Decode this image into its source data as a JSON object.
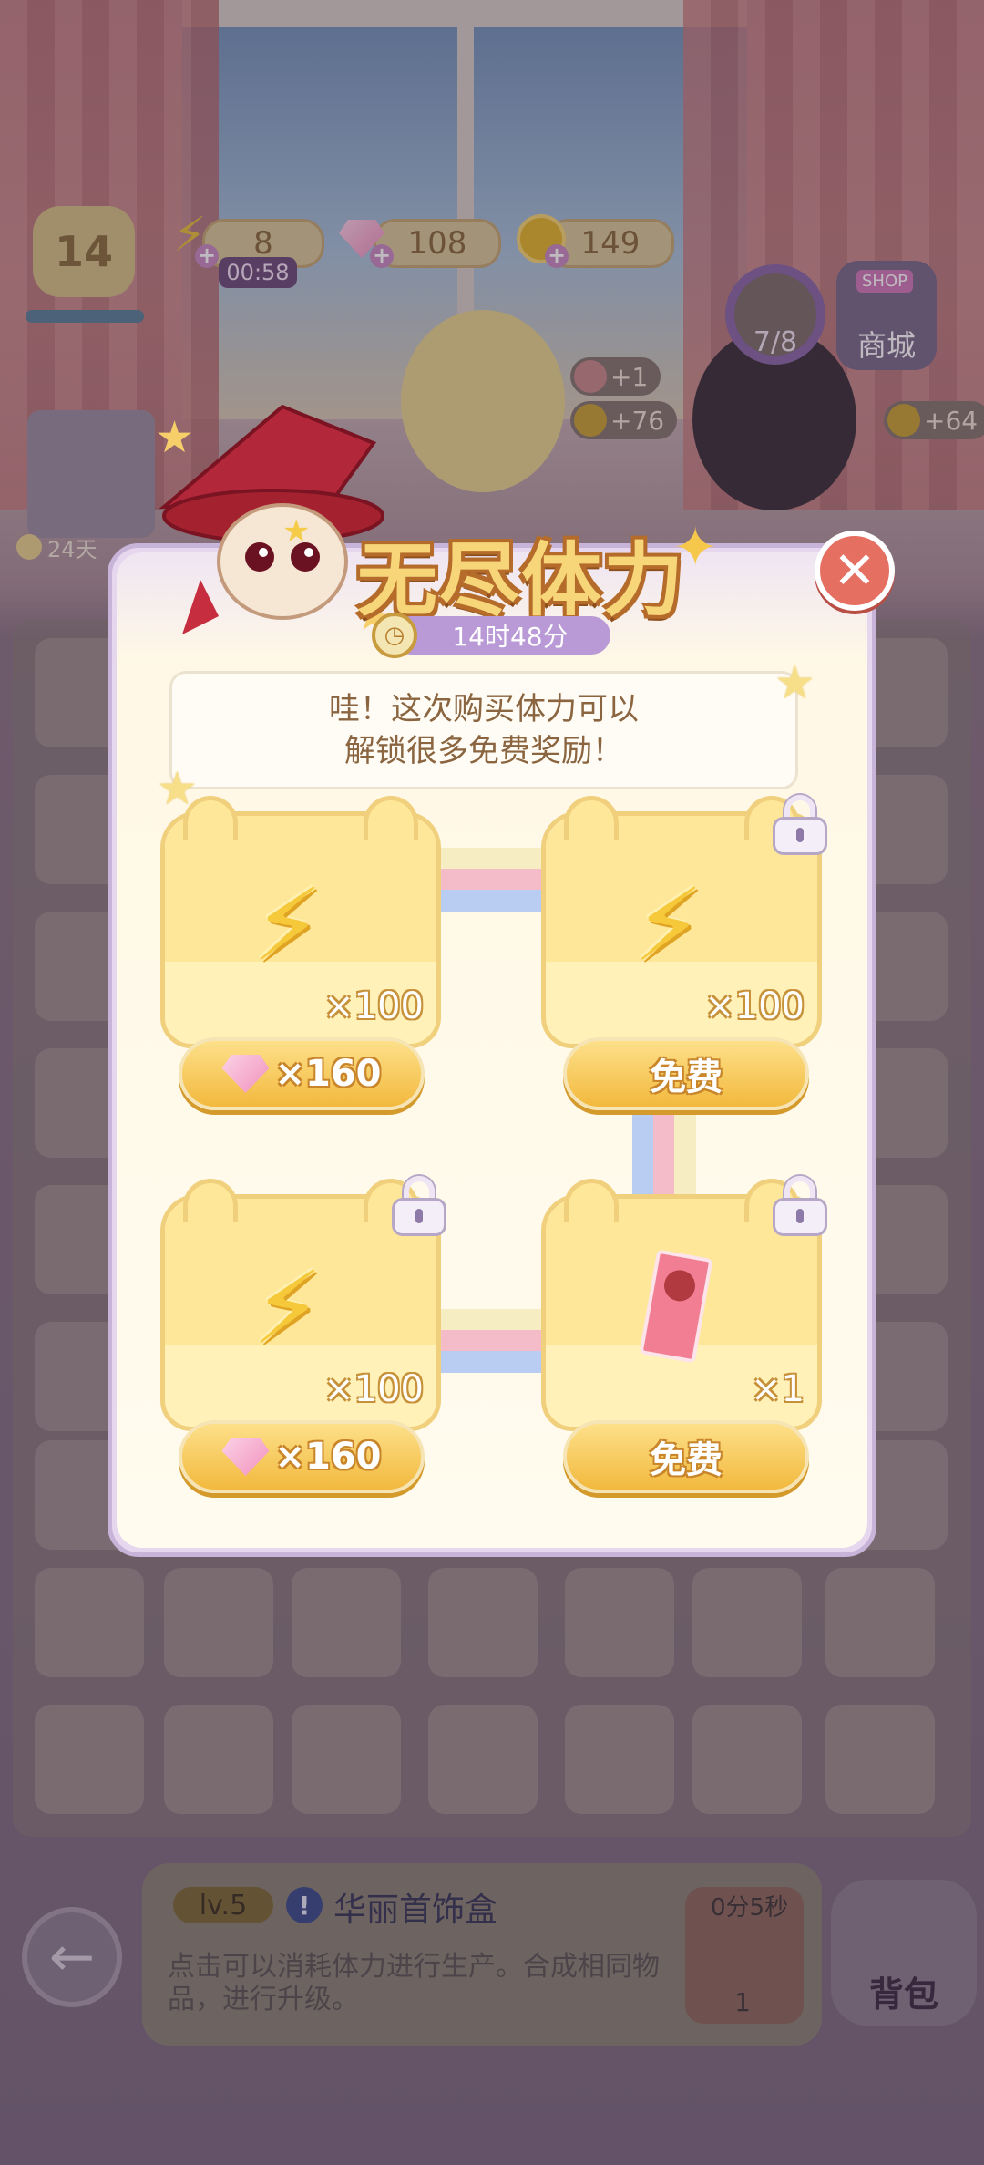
{
  "hud": {
    "energy": "8",
    "energy_timer": "00:58",
    "gems": "108",
    "coins": "149",
    "player_level": "14",
    "quest_progress": "7/8",
    "shop_label": "商城",
    "shop_sign": "SHOP",
    "reward_plus": "+1",
    "reward_coins_1": "+76",
    "reward_coins_2": "+64",
    "left_timer": "24天"
  },
  "popup": {
    "title": "无尽体力",
    "countdown": "14时48分",
    "message_line1": "哇！这次购买体力可以",
    "message_line2": "解锁很多免费奖励！",
    "close_icon": "close-x",
    "rewards": [
      {
        "qty": "×100",
        "price": "×160",
        "price_type": "gem",
        "locked": false
      },
      {
        "qty": "×100",
        "price": "免费",
        "price_type": "free",
        "locked": true
      },
      {
        "qty": "×100",
        "price": "×160",
        "price_type": "gem",
        "locked": true
      },
      {
        "qty": "×1",
        "price": "免费",
        "price_type": "free",
        "locked": true
      }
    ]
  },
  "bottom": {
    "item_level": "lv.5",
    "item_name": "华丽首饰盒",
    "item_desc": "点击可以消耗体力进行生产。合成相同物品，进行升级。",
    "produce_timer": "0分5秒",
    "produce_count": "1",
    "bag_label": "背包"
  },
  "colors": {
    "gold": "#f2b93d",
    "close_red": "#e57062",
    "countdown_purple": "#b99ad6",
    "card_yellow": "#ffe79a"
  }
}
